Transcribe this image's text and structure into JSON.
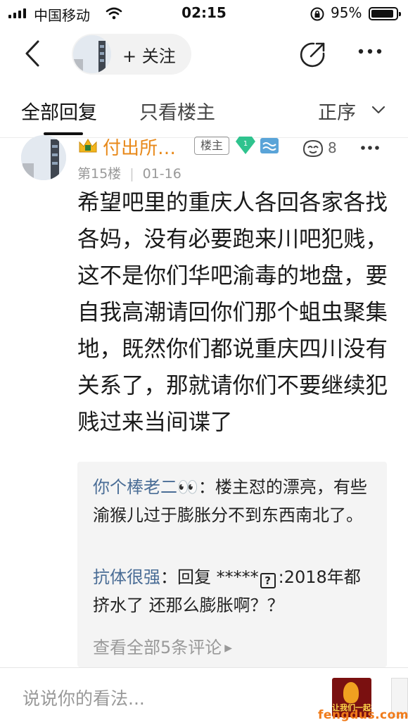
{
  "status_bar": {
    "carrier": "中国移动",
    "time": "02:15",
    "battery_percent": "95%",
    "battery_level": 0.95
  },
  "nav": {
    "follow_label": "+ 关注"
  },
  "tabs": {
    "all_replies": "全部回复",
    "op_only": "只看楼主",
    "sort": "正序"
  },
  "post": {
    "username": "付出所…",
    "op_badge": "楼主",
    "likes": "8",
    "floor": "第15楼",
    "date": "01-16",
    "body": "希望吧里的重庆人各回各家各找各妈，没有必要跑来川吧犯贱，这不是你们华吧渝毒的地盘，要自我高潮请回你们那个蛆虫聚集地，既然你们都说重庆四川没有关系了，那就请你们不要继续犯贱过来当间谍了"
  },
  "comments": {
    "items": [
      {
        "name": "你个棒老二👀",
        "separator": "：",
        "text": "楼主怼的漂亮，有些渝猴儿过于膨胀分不到东西南北了。"
      },
      {
        "name": "抗体很强",
        "separator": "：",
        "text_prefix": "回复 *****",
        "text_suffix": ":2018年都挤水了 还那么膨胀啊？？"
      }
    ],
    "view_all": "查看全部5条评论"
  },
  "bottom": {
    "input_placeholder": "说说你的看法...",
    "promo_text": "让我们一起祈福",
    "watermark": "fengdus.com"
  },
  "colors": {
    "username": "#e8891a",
    "comment_name": "#4a6d96",
    "watermark": "#f07b1a"
  }
}
